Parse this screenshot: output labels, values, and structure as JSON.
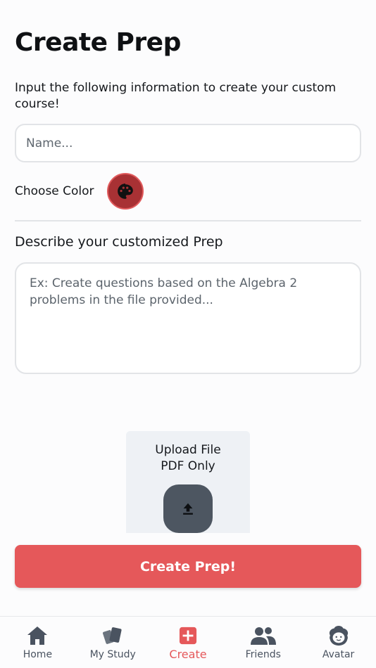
{
  "header": {
    "title": "Create Prep"
  },
  "intro": {
    "text": "Input the following information to create your custom course!"
  },
  "name_field": {
    "placeholder": "Name..."
  },
  "color_picker": {
    "label": "Choose Color",
    "selected_color": "#a83134",
    "icon": "palette-icon"
  },
  "describe": {
    "label": "Describe your customized Prep",
    "placeholder": "Ex: Create questions based on the Algebra 2 problems in the file provided..."
  },
  "upload": {
    "title": "Upload File",
    "subtitle": "PDF Only",
    "icon": "upload-icon"
  },
  "submit": {
    "label": "Create Prep!"
  },
  "colors": {
    "accent": "#e5585a",
    "icon_gray": "#4d5661",
    "tab_gray": "#4a5360"
  },
  "tabbar": {
    "items": [
      {
        "label": "Home",
        "icon": "home-icon",
        "active": false
      },
      {
        "label": "My Study",
        "icon": "cards-icon",
        "active": false
      },
      {
        "label": "Create",
        "icon": "plus-square-icon",
        "active": true
      },
      {
        "label": "Friends",
        "icon": "people-icon",
        "active": false
      },
      {
        "label": "Avatar",
        "icon": "avatar-face-icon",
        "active": false
      }
    ]
  }
}
